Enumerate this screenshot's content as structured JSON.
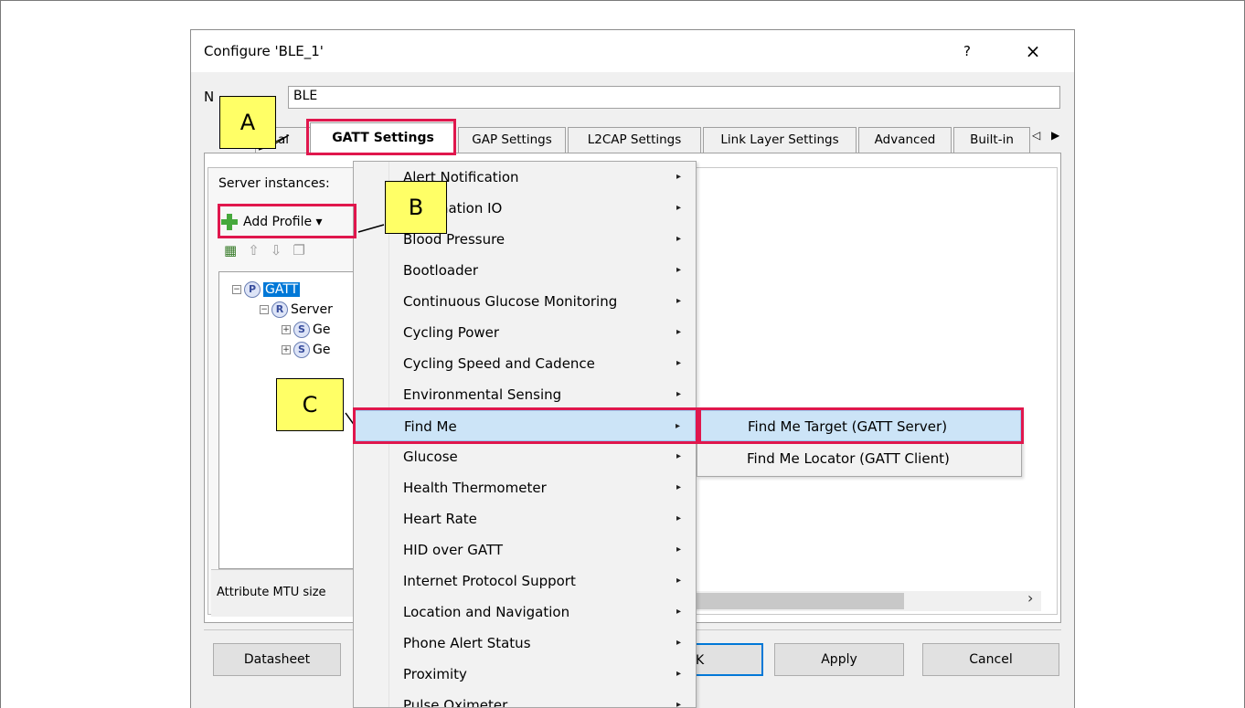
{
  "dialog": {
    "title": "Configure 'BLE_1'",
    "help": "?",
    "close": "×",
    "name_label": "N",
    "name_value": "BLE"
  },
  "tabs": {
    "items": [
      "al",
      "GATT Settings",
      "GAP Settings",
      "L2CAP Settings",
      "Link Layer Settings",
      "Advanced",
      "Built-in"
    ],
    "active": "GATT Settings",
    "scroll_arrows": "◁ ▶"
  },
  "left_pane": {
    "server_instances_label": "Server instances:",
    "add_profile_label": "Add Profile ▾",
    "toolbar_icons": [
      "add-service-icon",
      "move-up-icon",
      "move-down-icon",
      "copy-icon"
    ],
    "tree": {
      "root": {
        "badge": "P",
        "label": "GATT"
      },
      "server": {
        "badge": "R",
        "label": "Server"
      },
      "services": [
        {
          "badge": "S",
          "label": "Ge"
        },
        {
          "badge": "S",
          "label": "Ge"
        }
      ]
    },
    "mtu_label": "Attribute MTU size"
  },
  "footer": {
    "datasheet": "Datasheet",
    "ok_partial": "K",
    "apply": "Apply",
    "cancel": "Cancel"
  },
  "profile_menu": {
    "items": [
      "Alert Notification",
      "Automation IO",
      "Blood Pressure",
      "Bootloader",
      "Continuous Glucose Monitoring",
      "Cycling Power",
      "Cycling Speed and Cadence",
      "Environmental Sensing",
      "Find Me",
      "Glucose",
      "Health Thermometer",
      "Heart Rate",
      "HID over GATT",
      "Internet Protocol Support",
      "Location and Navigation",
      "Phone Alert Status",
      "Proximity",
      "Pulse Oximeter"
    ],
    "highlighted": "Find Me",
    "submenu_arrow": "▸"
  },
  "find_me_submenu": {
    "items": [
      "Find Me Target (GATT Server)",
      "Find Me Locator (GATT Client)"
    ],
    "highlighted": "Find Me Target (GATT Server)"
  },
  "callouts": {
    "a": "A",
    "b": "B",
    "c": "C"
  },
  "colors": {
    "callout_fill": "#ffff66",
    "highlight_border": "#e0174d",
    "menu_highlight": "#cce4f7",
    "selection": "#0078d7"
  }
}
